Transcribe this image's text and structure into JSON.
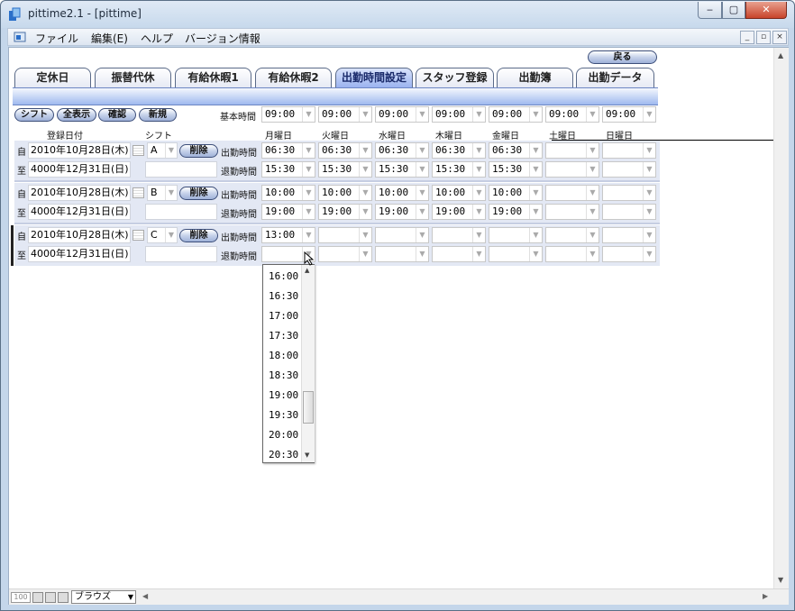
{
  "window": {
    "title": "pittime2.1 - [pittime]",
    "min": "‒",
    "max": "▢",
    "close": "✕"
  },
  "menu": {
    "items": [
      "ファイル",
      "編集(E)",
      "ヘルプ",
      "バージョン情報"
    ],
    "mdi": [
      "_",
      "▫",
      "×"
    ]
  },
  "nav": {
    "back": "戻る",
    "tabs": [
      "定休日",
      "振替代休",
      "有給休暇1",
      "有給休暇2",
      "出勤時間設定",
      "スタッフ登録",
      "出勤簿",
      "出勤データ"
    ],
    "active_tab": "出勤時間設定"
  },
  "toolbar": {
    "shift": "シフト",
    "show_all": "全表示",
    "confirm": "確認",
    "new": "新規",
    "base_time_label": "基本時間"
  },
  "base_times": [
    "09:00",
    "09:00",
    "09:00",
    "09:00",
    "09:00",
    "09:00",
    "09:00"
  ],
  "headers": {
    "date": "登録日付",
    "shift": "シフト",
    "days": [
      "月曜日",
      "火曜日",
      "水曜日",
      "木曜日",
      "金曜日",
      "土曜日",
      "日曜日"
    ]
  },
  "records": [
    {
      "from_mark": "自",
      "to_mark": "至",
      "from": "2010年10月28日(木)",
      "to": "4000年12月31日(日)",
      "shift": "A",
      "delete": "削除",
      "in_label": "出勤時間",
      "out_label": "退勤時間",
      "in": [
        "06:30",
        "06:30",
        "06:30",
        "06:30",
        "06:30",
        "",
        ""
      ],
      "out": [
        "15:30",
        "15:30",
        "15:30",
        "15:30",
        "15:30",
        "",
        ""
      ]
    },
    {
      "from_mark": "自",
      "to_mark": "至",
      "from": "2010年10月28日(木)",
      "to": "4000年12月31日(日)",
      "shift": "B",
      "delete": "削除",
      "in_label": "出勤時間",
      "out_label": "退勤時間",
      "in": [
        "10:00",
        "10:00",
        "10:00",
        "10:00",
        "10:00",
        "",
        ""
      ],
      "out": [
        "19:00",
        "19:00",
        "19:00",
        "19:00",
        "19:00",
        "",
        ""
      ]
    },
    {
      "from_mark": "自",
      "to_mark": "至",
      "from": "2010年10月28日(木)",
      "to": "4000年12月31日(日)",
      "shift": "C",
      "delete": "削除",
      "in_label": "出勤時間",
      "out_label": "退勤時間",
      "in": [
        "13:00",
        "",
        "",
        "",
        "",
        "",
        ""
      ],
      "out": [
        "",
        "",
        "",
        "",
        "",
        "",
        ""
      ]
    }
  ],
  "dropdown_options": [
    "16:00",
    "16:30",
    "17:00",
    "17:30",
    "18:00",
    "18:30",
    "19:00",
    "19:30",
    "20:00",
    "20:30"
  ],
  "status": {
    "zoom": "100",
    "mode": "ブラウズ"
  }
}
